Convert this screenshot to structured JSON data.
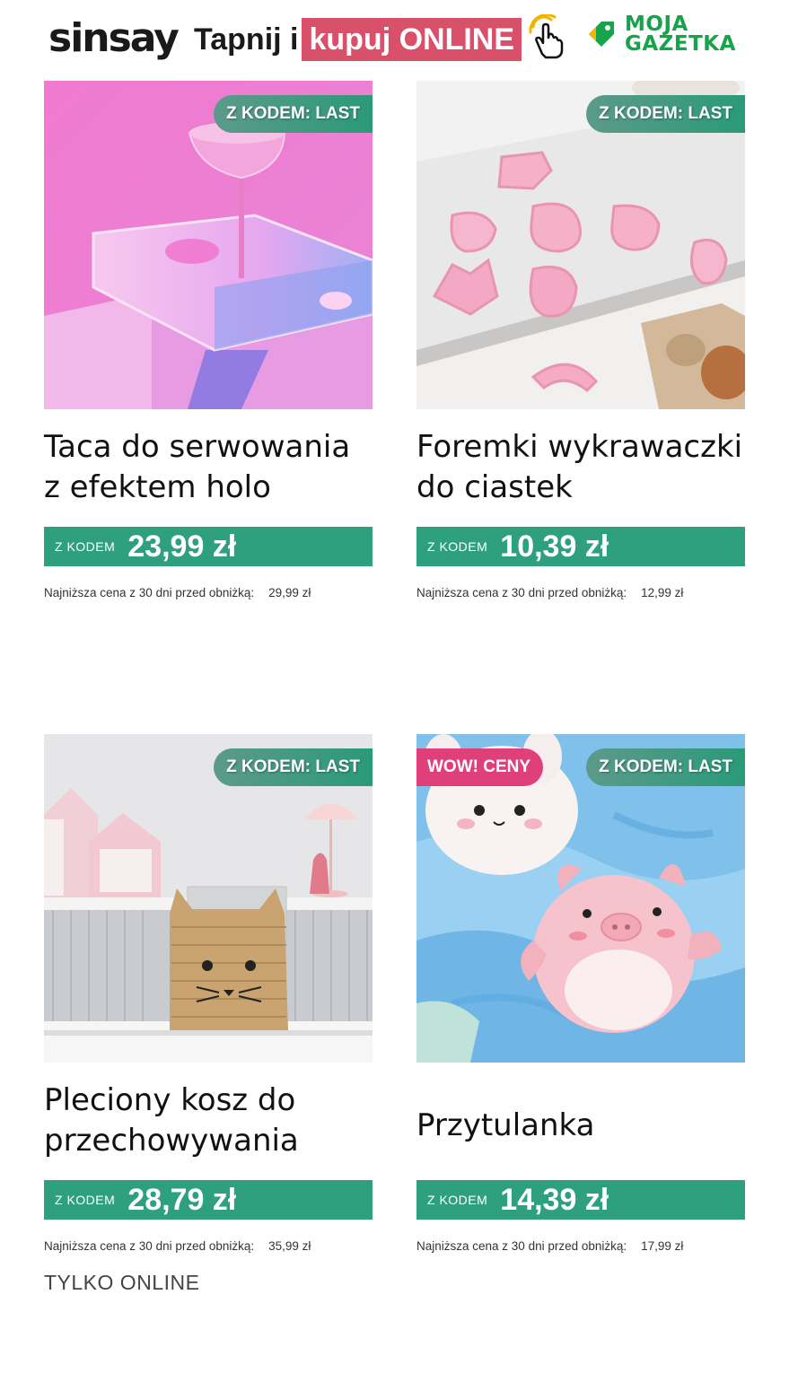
{
  "header": {
    "logo": "sinsay",
    "tagline_prefix": "Tapnij i",
    "tagline_highlight": "kupuj ONLINE",
    "tap_icon": "tap-hand-icon",
    "gazetka_line1": "MOJA",
    "gazetka_line2": "GAZETKA"
  },
  "colors": {
    "accent_pink": "#d9506a",
    "price_green": "#2fa07e",
    "gazetka_green": "#17a34a",
    "wow_pink": "#e0407a"
  },
  "products": [
    {
      "title_line1": "Taca do serwowania",
      "title_line2": "z efektem holo",
      "badge": "Z KODEM: LAST",
      "price_label": "Z KODEM",
      "price": "23,99 zł",
      "lowest_label": "Najniższa cena z 30 dni przed obniżką:",
      "lowest_price": "29,99 zł",
      "image": "holo-tray-with-glass"
    },
    {
      "title_line1": "Foremki wykrawaczki",
      "title_line2": "do ciastek",
      "badge": "Z KODEM: LAST",
      "price_label": "Z KODEM",
      "price": "10,39 zł",
      "lowest_label": "Najniższa cena z 30 dni przed obniżką:",
      "lowest_price": "12,99 zł",
      "image": "pink-cookie-cutters"
    },
    {
      "title_line1": "Pleciony kosz do",
      "title_line2": "przechowywania",
      "badge": "Z KODEM: LAST",
      "price_label": "Z KODEM",
      "price": "28,79 zł",
      "lowest_label": "Najniższa cena z 30 dni przed obniżką:",
      "lowest_price": "35,99 zł",
      "image": "woven-cat-basket"
    },
    {
      "title_line1": "Przytulanka",
      "title_line2": "",
      "badge": "Z KODEM: LAST",
      "badge_wow": "WOW! CENY",
      "price_label": "Z KODEM",
      "price": "14,39 zł",
      "lowest_label": "Najniższa cena z 30 dni przed obniżką:",
      "lowest_price": "17,99 zł",
      "image": "pink-pig-plush-toy"
    }
  ],
  "footer_note": "TYLKO ONLINE"
}
